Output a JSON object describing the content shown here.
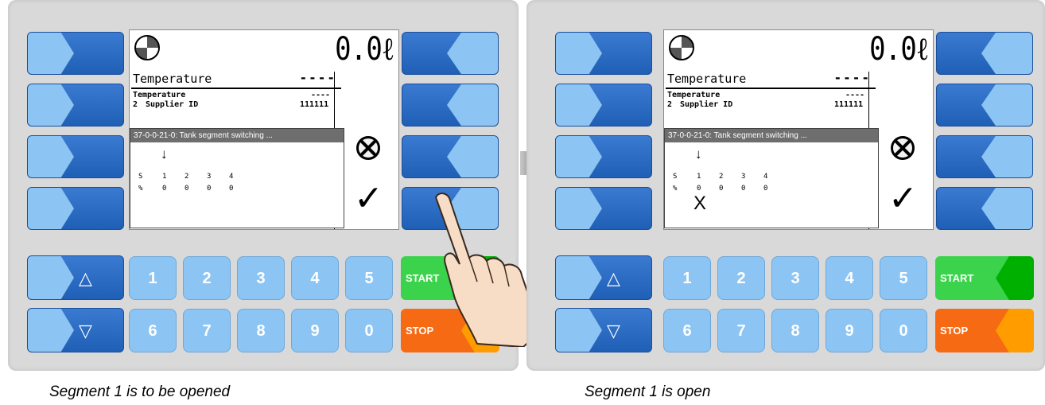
{
  "panels": [
    {
      "volume": "0.0ℓ",
      "header_label": "Temperature",
      "header_value": "----",
      "row1_label": "Temperature",
      "row1_value": "----",
      "row2_num": "2",
      "row2_label": "Supplier ID",
      "row2_value": "111111",
      "dialog_title": "37-0-0-21-0: Tank segment switching ...",
      "seg_label_s": "S",
      "seg_label_pct": "%",
      "segments": [
        "1",
        "2",
        "3",
        "4"
      ],
      "percents": [
        "0",
        "0",
        "0",
        "0"
      ],
      "open_mark": "",
      "caption": "Segment 1 is to be opened"
    },
    {
      "volume": "0.0ℓ",
      "header_label": "Temperature",
      "header_value": "----",
      "row1_label": "Temperature",
      "row1_value": "----",
      "row2_num": "2",
      "row2_label": "Supplier ID",
      "row2_value": "111111",
      "dialog_title": "37-0-0-21-0: Tank segment switching ...",
      "seg_label_s": "S",
      "seg_label_pct": "%",
      "segments": [
        "1",
        "2",
        "3",
        "4"
      ],
      "percents": [
        "0",
        "0",
        "0",
        "0"
      ],
      "open_mark": "X",
      "caption": "Segment 1 is open"
    }
  ],
  "keypad": {
    "up": "△",
    "down": "▽",
    "digits": [
      "1",
      "2",
      "3",
      "4",
      "5",
      "6",
      "7",
      "8",
      "9",
      "0"
    ],
    "start": "START",
    "stop": "STOP"
  },
  "icons": {
    "cancel": "cancel-icon",
    "confirm": "check-icon",
    "segment_pointer": "down-arrow-icon",
    "hand": "pointing-hand-icon"
  },
  "colors": {
    "softkey_dark": "#1f5fb5",
    "softkey_light": "#8cc5f3",
    "start": "#3bd34b",
    "stop": "#f66a14"
  }
}
